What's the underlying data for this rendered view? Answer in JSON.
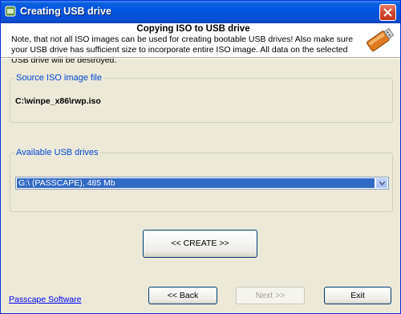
{
  "window": {
    "title": "Creating USB drive"
  },
  "header": {
    "title": "Copying ISO to USB drive",
    "note": "Note, that not all ISO images can be used for creating bootable USB drives! Also make sure your USB drive has sufficient size to incorporate entire ISO image. All data on the selected USB drive will be destroyed."
  },
  "source": {
    "legend": "Source ISO image file",
    "path": "C:\\winpe_x86\\rwp.iso"
  },
  "drives": {
    "legend": "Available USB drives",
    "selected": "G:\\ (PASSCAPE),  485 Mb"
  },
  "actions": {
    "create_label": "<< CREATE >>"
  },
  "footer": {
    "link": "Passcape Software",
    "back_label": "<< Back",
    "next_label": "Next >>",
    "exit_label": "Exit"
  },
  "colors": {
    "titlebar": "#0054e3",
    "selection": "#316ac5",
    "legend": "#0046d5",
    "link": "#0000ff"
  }
}
